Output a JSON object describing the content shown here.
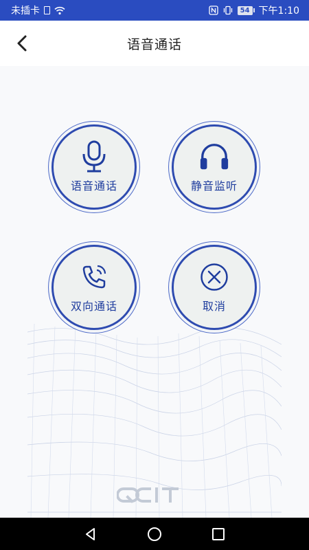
{
  "status_bar": {
    "carrier": "未插卡",
    "battery": "54",
    "time": "下午1:10"
  },
  "header": {
    "title": "语音通话",
    "back_icon": "chevron-left-icon"
  },
  "actions": [
    {
      "label": "语音通话",
      "icon": "microphone-icon"
    },
    {
      "label": "静音监听",
      "icon": "headphones-icon"
    },
    {
      "label": "双向通话",
      "icon": "phone-ringing-icon"
    },
    {
      "label": "取消",
      "icon": "close-circle-icon"
    }
  ],
  "logo": {
    "text": "QCIT"
  },
  "colors": {
    "status_bar": "#2a4cc0",
    "accent": "#1f3d9e",
    "background": "#f8f9fb"
  }
}
